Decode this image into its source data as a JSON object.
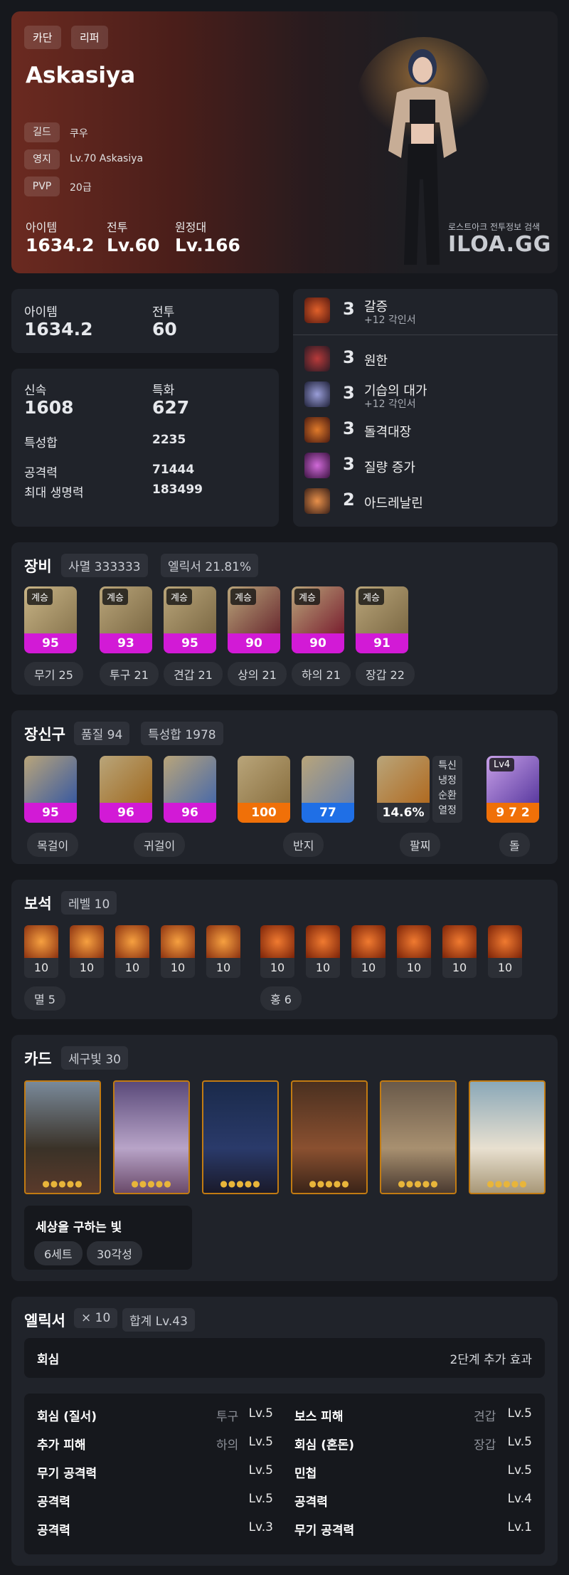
{
  "hero": {
    "tags": [
      "카단",
      "리퍼"
    ],
    "name": "Askasiya",
    "info": [
      {
        "label": "길드",
        "value": "쿠우"
      },
      {
        "label": "영지",
        "value": "Lv.70 Askasiya"
      },
      {
        "label": "PVP",
        "value": "20급"
      }
    ],
    "stats": [
      {
        "label": "아이템",
        "value": "1634.2"
      },
      {
        "label": "전투",
        "value": "Lv.60"
      },
      {
        "label": "원정대",
        "value": "Lv.166"
      }
    ],
    "brand_sub": "로스트아크 전투정보 검색",
    "brand": "ILOA.GG"
  },
  "summary": {
    "item_label": "아이템",
    "item_value": "1634.2",
    "combat_label": "전투",
    "combat_value": "60"
  },
  "stats": {
    "swift_label": "신속",
    "swift_value": "1608",
    "spec_label": "특화",
    "spec_value": "627",
    "total_label": "특성합",
    "total_value": "2235",
    "atk_label": "공격력",
    "atk_value": "71444",
    "hp_label": "최대 생명력",
    "hp_value": "183499"
  },
  "engravings": {
    "top": {
      "level": "3",
      "name": "갈증",
      "sub": "+12 각인서"
    },
    "items": [
      {
        "level": "3",
        "name": "원한",
        "sub": ""
      },
      {
        "level": "3",
        "name": "기습의 대가",
        "sub": "+12 각인서"
      },
      {
        "level": "3",
        "name": "돌격대장",
        "sub": ""
      },
      {
        "level": "3",
        "name": "질량 증가",
        "sub": ""
      },
      {
        "level": "2",
        "name": "아드레날린",
        "sub": ""
      }
    ]
  },
  "equipment": {
    "title": "장비",
    "chips": [
      "사멸 333333",
      "엘릭서 21.81%"
    ],
    "items": [
      {
        "tag": "계승",
        "quality": "95",
        "label": "무기 25"
      },
      {
        "tag": "계승",
        "quality": "93",
        "label": "투구 21"
      },
      {
        "tag": "계승",
        "quality": "95",
        "label": "견갑 21"
      },
      {
        "tag": "계승",
        "quality": "90",
        "label": "상의 21"
      },
      {
        "tag": "계승",
        "quality": "90",
        "label": "하의 21"
      },
      {
        "tag": "계승",
        "quality": "91",
        "label": "장갑 22"
      }
    ]
  },
  "accessories": {
    "title": "장신구",
    "chips": [
      "품질 94",
      "특성합 1978"
    ],
    "items": [
      {
        "quality": "95"
      },
      {
        "quality": "96"
      },
      {
        "quality": "96"
      },
      {
        "quality": "100"
      },
      {
        "quality": "77"
      }
    ],
    "labels": [
      "목걸이",
      "귀걸이",
      "반지",
      "팔찌",
      "돌"
    ],
    "bracelet_value": "14.6%",
    "bracelet_effects": [
      "특신",
      "냉정",
      "순환",
      "열정"
    ],
    "stone_level": "Lv4",
    "stone_value": "9 7 2"
  },
  "gems": {
    "title": "보석",
    "chips": [
      "레벨 10"
    ],
    "group1": [
      "10",
      "10",
      "10",
      "10",
      "10"
    ],
    "group2": [
      "10",
      "10",
      "10",
      "10",
      "10",
      "10"
    ],
    "label1": "멸 5",
    "label2": "홍 6"
  },
  "cards": {
    "title": "카드",
    "chips": [
      "세구빛 30"
    ],
    "set_name": "세상을 구하는 빛",
    "set_chips": [
      "6세트",
      "30각성"
    ]
  },
  "elixir": {
    "title": "엘릭서",
    "chips": [
      "× 10",
      "합계 Lv.43"
    ],
    "effect_name": "회심",
    "effect_desc": "2단계 추가 효과",
    "left": [
      {
        "name": "회심 (질서)",
        "part": "투구",
        "lv": "Lv.5"
      },
      {
        "name": "추가 피해",
        "part": "하의",
        "lv": "Lv.5"
      },
      {
        "name": "무기 공격력",
        "part": "",
        "lv": "Lv.5"
      },
      {
        "name": "공격력",
        "part": "",
        "lv": "Lv.5"
      },
      {
        "name": "공격력",
        "part": "",
        "lv": "Lv.3"
      }
    ],
    "right": [
      {
        "name": "보스 피해",
        "part": "견갑",
        "lv": "Lv.5"
      },
      {
        "name": "회심 (혼돈)",
        "part": "장갑",
        "lv": "Lv.5"
      },
      {
        "name": "민첩",
        "part": "",
        "lv": "Lv.5"
      },
      {
        "name": "공격력",
        "part": "",
        "lv": "Lv.4"
      },
      {
        "name": "무기 공격력",
        "part": "",
        "lv": "Lv.1"
      }
    ]
  }
}
